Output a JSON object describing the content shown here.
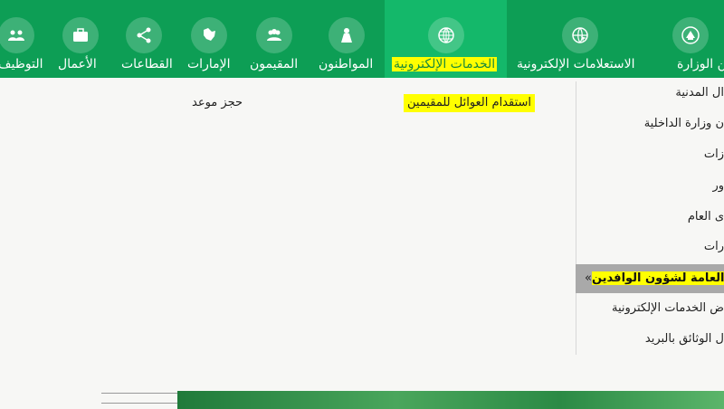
{
  "nav": {
    "items": [
      {
        "label": "عن الوزارة",
        "icon": "emblem-icon"
      },
      {
        "label": "الاستعلامات الإلكترونية",
        "icon": "globe-cursor-icon"
      },
      {
        "label": "الخدمات الإلكترونية",
        "icon": "globe-icon",
        "active": true
      },
      {
        "label": "المواطنون",
        "icon": "citizen-icon"
      },
      {
        "label": "المقيمون",
        "icon": "residents-icon"
      },
      {
        "label": "الإمارات",
        "icon": "map-icon"
      },
      {
        "label": "القطاعات",
        "icon": "network-icon"
      },
      {
        "label": "الأعمال",
        "icon": "briefcase-icon"
      },
      {
        "label": "التوظيف",
        "icon": "people-icon"
      }
    ]
  },
  "menu": {
    "items": [
      "ال المدنية",
      "ن وزارة الداخلية",
      "زات",
      "ور",
      "ى العام",
      "رات",
      "رة العامة لشؤون الوافدين",
      "ض الخدمات الإلكترونية",
      "ل الوثائق بالبريد"
    ],
    "selected_marker": "«"
  },
  "submenu": {
    "link1": "استقدام العوائل للمقيمين",
    "link2": "حجز موعد"
  },
  "colors": {
    "nav_bg": "#0d9e55",
    "nav_active": "#14b86a",
    "highlight": "#ffff00"
  }
}
